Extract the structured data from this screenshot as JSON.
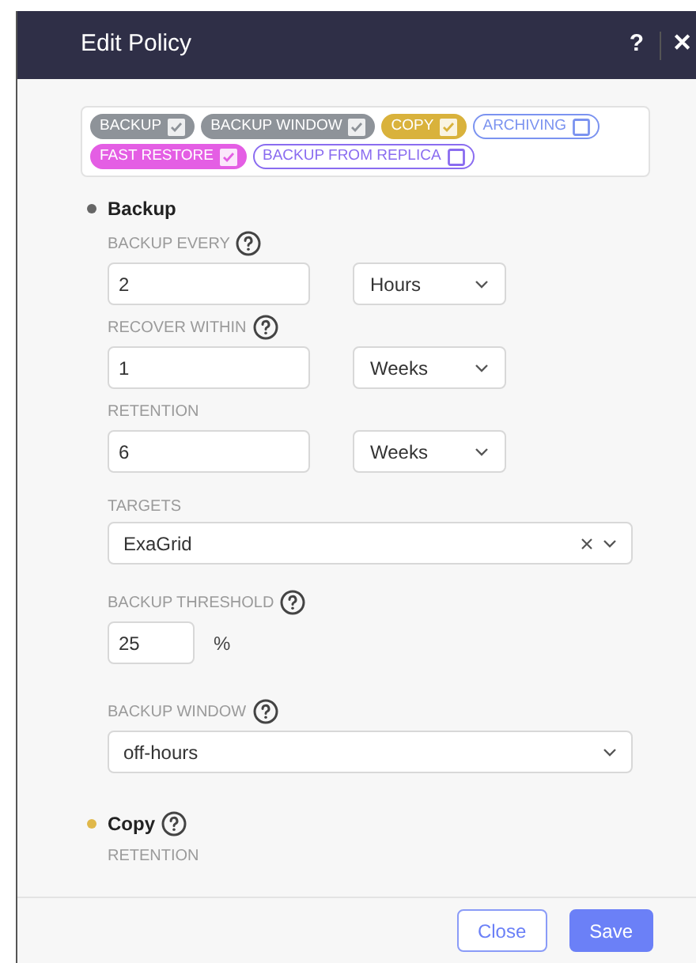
{
  "dialog": {
    "title": "Edit Policy",
    "help": "?",
    "close": "✕"
  },
  "tags": [
    {
      "label": "BACKUP",
      "checked": true,
      "color": "#8e9399"
    },
    {
      "label": "BACKUP WINDOW",
      "checked": true,
      "color": "#8e9399"
    },
    {
      "label": "COPY",
      "checked": true,
      "color": "#d9b23c"
    },
    {
      "label": "ARCHIVING",
      "checked": false,
      "color": "#7b93f0"
    },
    {
      "label": "FAST RESTORE",
      "checked": true,
      "color": "#e45ee4"
    },
    {
      "label": "BACKUP FROM REPLICA",
      "checked": false,
      "color": "#8a6cf0"
    }
  ],
  "sections": [
    {
      "title": "Backup",
      "color": "#666666",
      "help": false,
      "fields": [
        {
          "kind": "amount",
          "label": "BACKUP EVERY",
          "help": true,
          "value": "2",
          "unit": "Hours"
        },
        {
          "kind": "amount",
          "label": "RECOVER WITHIN",
          "help": true,
          "value": "1",
          "unit": "Weeks"
        },
        {
          "kind": "amount",
          "label": "RETENTION",
          "help": false,
          "value": "6",
          "unit": "Weeks"
        },
        {
          "kind": "multiselect",
          "label": "TARGETS",
          "help": false,
          "value": "ExaGrid"
        },
        {
          "kind": "percent",
          "label": "BACKUP THRESHOLD",
          "help": true,
          "value": "25",
          "unit": "%"
        },
        {
          "kind": "select",
          "label": "BACKUP WINDOW",
          "help": true,
          "value": "off-hours"
        }
      ]
    },
    {
      "title": "Copy",
      "color": "#e0b84a",
      "help": true,
      "fields": [
        {
          "kind": "label",
          "label": "RETENTION",
          "help": false
        }
      ]
    }
  ],
  "buttons": [
    {
      "label": "Close",
      "kind": "secondary"
    },
    {
      "label": "Save",
      "kind": "primary"
    }
  ]
}
